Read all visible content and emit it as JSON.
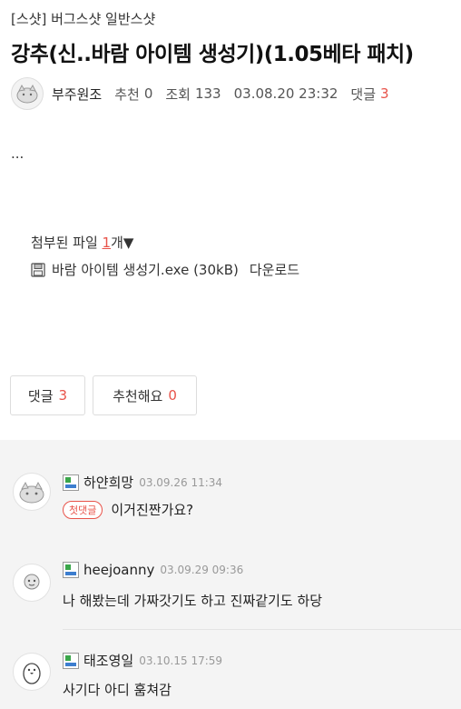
{
  "post": {
    "category": "[스샷] 버그스샷 일반스샷",
    "title": "강추(신..바람 아이템 생성기)(1.05베타 패치)",
    "author": "부주원조",
    "recommend_label": "추천",
    "recommend_count": "0",
    "views_label": "조회",
    "views_count": "133",
    "date": "03.08.20 23:32",
    "comments_label": "댓글",
    "comments_count": "3",
    "body": "..."
  },
  "attachments": {
    "heading_prefix": "첨부된 파일 ",
    "count": "1",
    "heading_suffix": "개",
    "toggle": "▼",
    "file_name": "바람 아이템 생성기.exe (30kB)",
    "download_label": "다운로드"
  },
  "buttons": {
    "comment_label": "댓글",
    "comment_count": "3",
    "recommend_label": "추천해요",
    "recommend_count": "0"
  },
  "comments": [
    {
      "name": "하얀희망",
      "date": "03.09.26 11:34",
      "badge": "첫댓글",
      "text": "이거진짠가요?"
    },
    {
      "name": "heejoanny",
      "date": "03.09.29 09:36",
      "badge": "",
      "text": "나 해봤는데 가짜갓기도 하고 진짜같기도 하당"
    },
    {
      "name": "태조영일",
      "date": "03.10.15 17:59",
      "badge": "",
      "text": "사기다 아디 훔쳐감"
    }
  ],
  "colors": {
    "accent": "#e8534a",
    "comment_bg": "#f4f4f4"
  }
}
